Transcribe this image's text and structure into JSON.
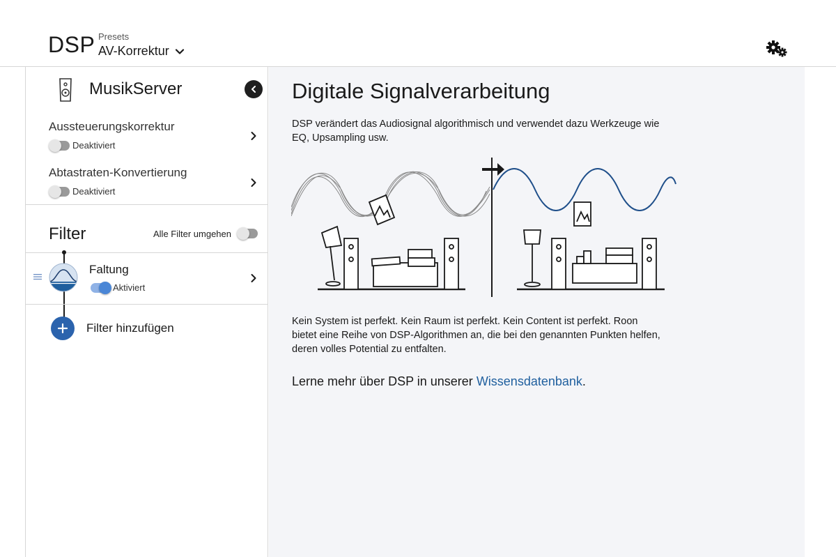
{
  "header": {
    "title": "DSP",
    "presets_label": "Presets",
    "preset_value": "AV-Korrektur"
  },
  "sidebar": {
    "device_name": "MusikServer",
    "settings": [
      {
        "label": "Aussteuerungskorrektur",
        "status": "Deaktiviert",
        "enabled": false
      },
      {
        "label": "Abtastraten-Konvertierung",
        "status": "Deaktiviert",
        "enabled": false
      }
    ],
    "filter_heading": "Filter",
    "bypass_label": "Alle Filter umgehen",
    "bypass_enabled": false,
    "filters": [
      {
        "name": "Faltung",
        "status": "Aktiviert",
        "enabled": true
      }
    ],
    "add_filter_label": "Filter hinzufügen"
  },
  "main": {
    "title": "Digitale Signalverarbeitung",
    "intro": "DSP verändert das Audiosignal algorithmisch und verwendet dazu Werkzeuge wie EQ, Upsampling usw.",
    "body": "Kein System ist perfekt. Kein Raum ist perfekt. Kein Content ist perfekt. Roon bietet eine Reihe von DSP-Algorithmen an, die bei den genannten Punkten helfen, deren volles Potential zu entfalten.",
    "learn_more_prefix": "Lerne mehr über DSP in unserer ",
    "learn_more_link": "Wissensdatenbank",
    "learn_more_suffix": "."
  },
  "icons": {
    "settings": "gears-icon",
    "device": "speaker-icon",
    "collapse": "chevron-left-icon",
    "dropdown": "chevron-down-icon",
    "row": "chevron-right-icon",
    "filter": "convolution-filter-icon",
    "add": "plus-icon",
    "drag": "drag-handle-icon"
  },
  "colors": {
    "accent": "#2b63ad",
    "link": "#1f5f9e",
    "toggle_on": "#4a86d6",
    "wave_clean": "#1f4f8a",
    "main_bg": "#f4f5f8"
  }
}
